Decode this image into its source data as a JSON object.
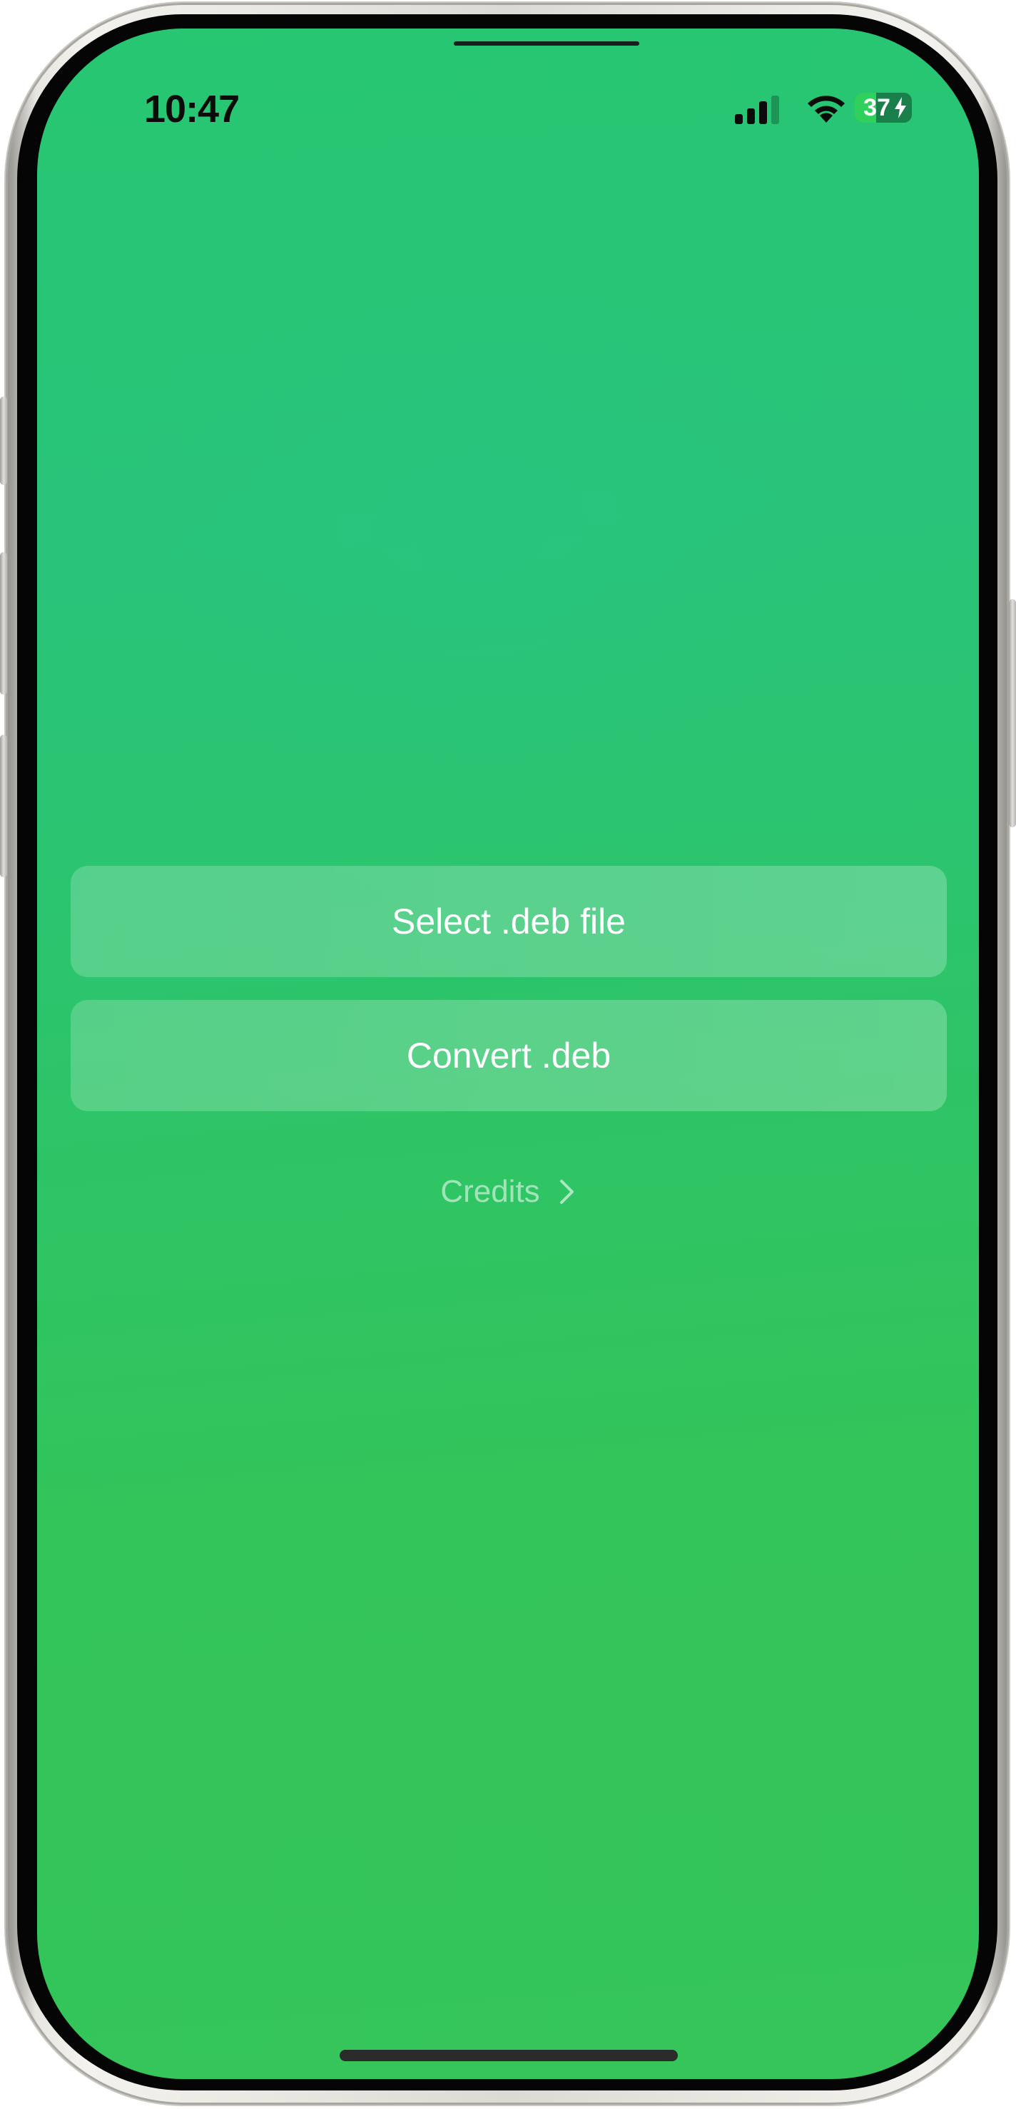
{
  "status_bar": {
    "time": "10:47",
    "battery_level": "37",
    "signal_bars": 3,
    "icons": [
      "signal-icon",
      "wifi-icon",
      "battery-icon",
      "charging-bolt-icon"
    ]
  },
  "main": {
    "select_button_label": "Select .deb file",
    "convert_button_label": "Convert .deb",
    "credits_link_label": "Credits",
    "credits_icon": "chevron-right-icon"
  },
  "colors": {
    "background_top": "#27c671",
    "background_bottom": "#35c55a",
    "button_fill": "rgba(255,255,255,0.22)",
    "text": "#ffffff"
  }
}
